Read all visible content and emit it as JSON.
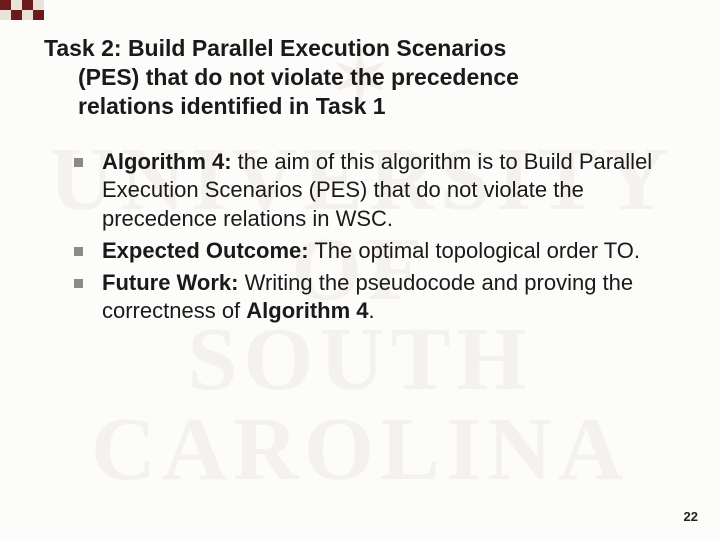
{
  "watermark": {
    "line1": "UNIVERSITY OF",
    "line2": "SOUTH",
    "line3": "CAROLINA"
  },
  "title": {
    "line1": "Task 2: Build Parallel Execution Scenarios",
    "line2": "(PES) that do not violate the precedence",
    "line3": "relations identified in Task 1"
  },
  "bullets": [
    {
      "label": "Algorithm 4:",
      "text": " the aim of this algorithm is to Build Parallel Execution Scenarios (PES) that do not violate the precedence relations in WSC."
    },
    {
      "label": "Expected Outcome:",
      "text": " The optimal topological order TO."
    },
    {
      "label": "Future Work:",
      "text_a": " Writing the pseudocode and proving the correctness of ",
      "bold_tail": "Algorithm 4",
      "text_b": "."
    }
  ],
  "page_number": "22"
}
